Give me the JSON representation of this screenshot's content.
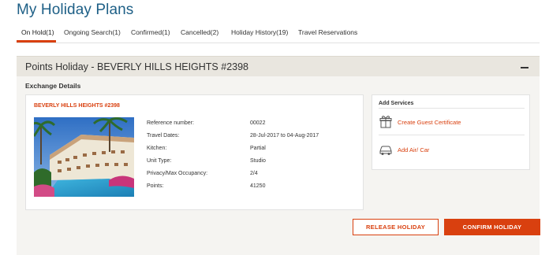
{
  "page_title": "My Holiday Plans",
  "tabs": [
    {
      "label": "On Hold(1)",
      "active": true
    },
    {
      "label": "Ongoing Search(1)",
      "active": false
    },
    {
      "label": "Confirmed(1)",
      "active": false
    },
    {
      "label": "Cancelled(2)",
      "active": false
    },
    {
      "label": "Holiday History(19)",
      "active": false
    },
    {
      "label": "Travel Reservations",
      "active": false
    }
  ],
  "panel": {
    "title": "Points Holiday - BEVERLY HILLS HEIGHTS #2398",
    "collapse_icon": "minus-icon",
    "section_label": "Exchange Details"
  },
  "details": {
    "resort_name": "BEVERLY HILLS HEIGHTS #2398",
    "photo": "resort-photo",
    "rows": [
      {
        "label": "Reference number:",
        "value": "00022"
      },
      {
        "label": "Travel Dates:",
        "value": "28-Jul-2017 to 04-Aug-2017"
      },
      {
        "label": "Kitchen:",
        "value": "Partial"
      },
      {
        "label": "Unit Type:",
        "value": "Studio"
      },
      {
        "label": "Privacy/Max Occupancy:",
        "value": "2/4"
      },
      {
        "label": "Points:",
        "value": "41250"
      }
    ]
  },
  "services": {
    "title": "Add Services",
    "items": [
      {
        "label": "Create Guest Certificate",
        "icon": "gift-icon"
      },
      {
        "label": "Add Air/ Car",
        "icon": "car-icon"
      }
    ]
  },
  "actions": {
    "release_label": "RELEASE HOLIDAY",
    "confirm_label": "CONFIRM HOLIDAY"
  },
  "colors": {
    "accent": "#d9400f",
    "title_blue": "#1d5f86",
    "panel_bg": "#f5f4f1",
    "panel_header_bg": "#e9e6df"
  }
}
